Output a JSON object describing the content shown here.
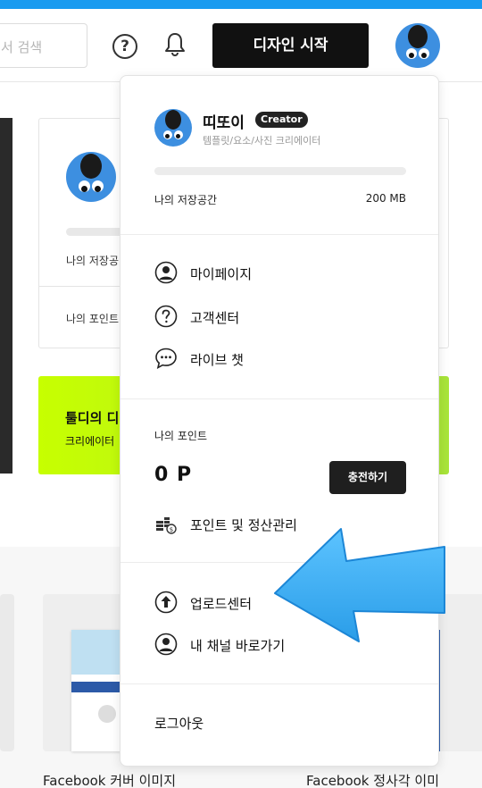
{
  "header": {
    "search_placeholder": "서 검색",
    "help_label": "?",
    "start_button": "디자인 시작"
  },
  "background": {
    "storage_label_partial": "나의 저장공",
    "points_label_partial": "나의 포인트",
    "promo_title": "툴디의 디",
    "promo_sub": "크리에이터",
    "captions": [
      "Facebook 커버 이미지",
      "Facebook 정사각 이미"
    ]
  },
  "dropdown": {
    "user_name": "띠또이",
    "badge": "Creator",
    "subtitle": "템플릿/요소/사진 크리에이터",
    "storage_label": "나의 저장공간",
    "storage_value": "200 MB",
    "storage_used_fraction": 0,
    "menu": [
      {
        "label": "마이페이지",
        "icon": "user-circle-icon"
      },
      {
        "label": "고객센터",
        "icon": "question-circle-icon"
      },
      {
        "label": "라이브 챗",
        "icon": "chat-bubble-icon"
      }
    ],
    "points_title": "나의 포인트",
    "points_value": "0 P",
    "charge_button": "충전하기",
    "points_manage": "포인트 및 정산관리",
    "upload_center": "업로드센터",
    "my_channel": "내 채널 바로가기",
    "logout": "로그아웃"
  },
  "colors": {
    "accent_bar": "#1a9bf0",
    "avatar_bg": "#3d8fe0",
    "promo_green": "#c7ff00",
    "arrow_blue": "#38aef5"
  }
}
